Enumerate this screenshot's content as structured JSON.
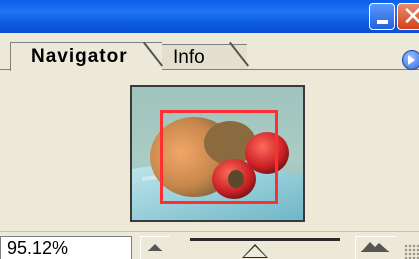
{
  "window": {
    "title_bar_color": "#0a5fe6",
    "minimize_icon": "minimize-icon",
    "close_icon": "close-icon",
    "close_glyph": "✕"
  },
  "tabs": [
    {
      "label": "Navigator",
      "active": true
    },
    {
      "label": "Info",
      "active": false
    }
  ],
  "palette_menu_icon": "palette-menu-arrow-icon",
  "preview": {
    "description_icon": "image-thumbnail",
    "view_box_color": "#ff2f2f"
  },
  "zoom": {
    "value": "95.12%",
    "slider_fraction": 0.45,
    "zoom_out_icon": "small-mountain-icon",
    "zoom_in_icon": "large-mountain-icon"
  }
}
